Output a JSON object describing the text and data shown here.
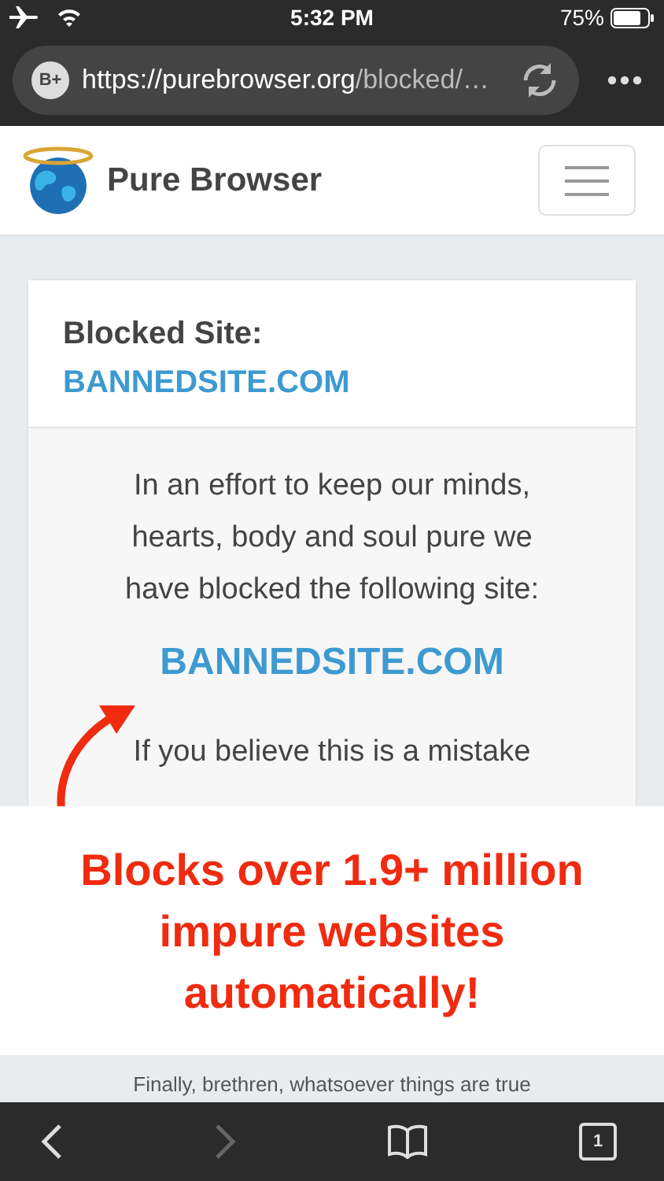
{
  "status_bar": {
    "time": "5:32 PM",
    "battery": "75%"
  },
  "address_bar": {
    "favicon_label": "B+",
    "url": "https://purebrowser.org",
    "url_path": "/blocked/…"
  },
  "navbar": {
    "brand": "Pure Browser"
  },
  "card": {
    "title": "Blocked Site:",
    "domain": "BANNEDSITE.COM",
    "message": "In an effort to keep our minds, hearts, body and soul pure we have blocked the following site:",
    "blocked_domain": "BANNEDSITE.COM",
    "note": "If you believe this is a mistake"
  },
  "banner": {
    "text": "Blocks over 1.9+ million impure websites automatically!"
  },
  "footer": {
    "quote": "Finally, brethren, whatsoever things are true"
  },
  "toolbar": {
    "tab_count": "1"
  }
}
